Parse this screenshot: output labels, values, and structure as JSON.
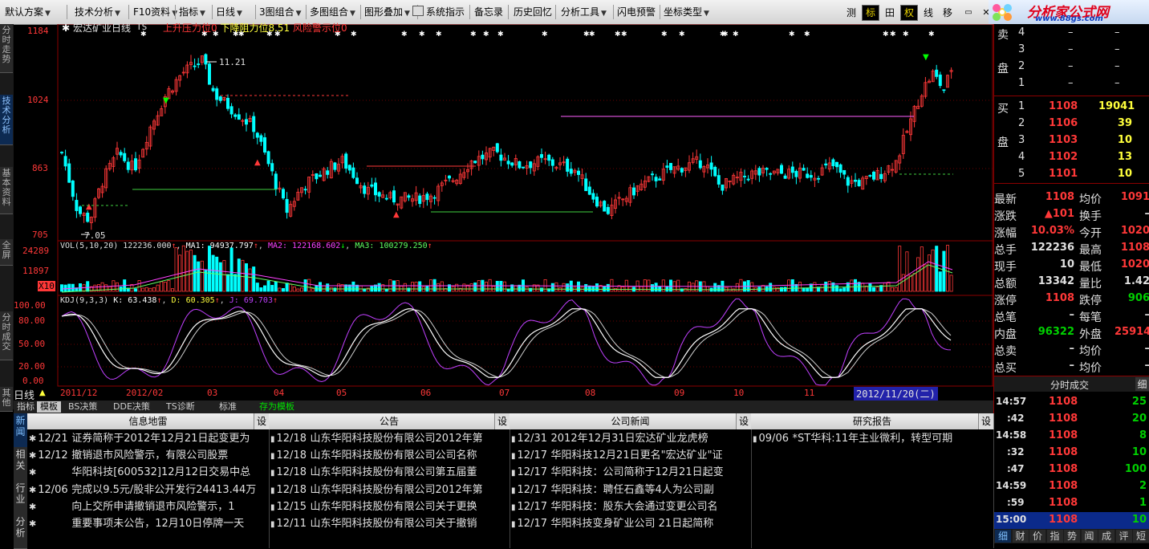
{
  "menu": {
    "items": [
      "默认方案",
      "技术分析",
      "F10资料",
      "指标",
      "日线",
      "3图组合",
      "多图组合",
      "图形叠加",
      "系统指示",
      "备忘录",
      "历史回忆",
      "分析工具",
      "闪电预警",
      "坐标类型"
    ],
    "tools": [
      "测",
      "标",
      "田",
      "权",
      "线",
      "移"
    ],
    "logo_text": "分析家公式网",
    "logo_url": "www.88gs.com"
  },
  "left_tabs": [
    "分时走势",
    "技术分析",
    "基本资料",
    "全屏",
    "分时成交",
    "其他"
  ],
  "chart": {
    "stock_name": "宏达矿业日线",
    "ts": "TS",
    "indicator_legend": [
      {
        "text": "上升压力位0",
        "color": "#ff3838"
      },
      {
        "text": "下降阻力位8.51",
        "color": "#ffff3c"
      },
      {
        "text": "风险警示位0",
        "color": "#ff3838"
      }
    ],
    "price_axis": [
      "1184",
      "1024",
      "863",
      "705"
    ],
    "high_label": "11.21",
    "low_label": "7.05",
    "vol_legend": {
      "title": "VOL(5,10,20)",
      "value": "122236.000",
      "ma1": "MA1: 94937.797",
      "ma2": "MA2: 122168.602",
      "ma3": "MA3: 100279.250"
    },
    "vol_axis": [
      "24289",
      "11897",
      "X10"
    ],
    "kdj_legend": {
      "title": "KDJ(9,3,3)",
      "k": "K: 63.438",
      "d": "D: 60.305",
      "j": "J: 69.703"
    },
    "kdj_axis": [
      "100.00",
      "80.00",
      "50.00",
      "20.00",
      "0.00"
    ],
    "period": "日线",
    "date_axis": [
      "2011/12",
      "2012/02",
      "03",
      "04",
      "05",
      "06",
      "07",
      "08",
      "09",
      "10",
      "11"
    ],
    "current_date": "2012/11/20(二)"
  },
  "order_book": {
    "sell": [
      {
        "label": "卖",
        "n": "4",
        "price": "–",
        "vol": "–"
      },
      {
        "label": "",
        "n": "3",
        "price": "–",
        "vol": "–"
      },
      {
        "label": "盘",
        "n": "2",
        "price": "–",
        "vol": "–"
      },
      {
        "label": "",
        "n": "1",
        "price": "–",
        "vol": "–"
      }
    ],
    "buy": [
      {
        "label": "买",
        "n": "1",
        "price": "1108",
        "vol": "19041"
      },
      {
        "label": "",
        "n": "2",
        "price": "1106",
        "vol": "39"
      },
      {
        "label": "盘",
        "n": "3",
        "price": "1103",
        "vol": "10"
      },
      {
        "label": "",
        "n": "4",
        "price": "1102",
        "vol": "13"
      },
      {
        "label": "",
        "n": "5",
        "price": "1101",
        "vol": "10"
      }
    ]
  },
  "quote": [
    {
      "l": "最新",
      "v": "1108",
      "vc": "red",
      "l2": "均价",
      "v2": "1091",
      "v2c": "red"
    },
    {
      "l": "涨跌",
      "v": "▲101",
      "vc": "red",
      "l2": "换手",
      "v2": "–",
      "v2c": "wht"
    },
    {
      "l": "涨幅",
      "v": "10.03%",
      "vc": "red",
      "l2": "今开",
      "v2": "1020",
      "v2c": "red"
    },
    {
      "l": "总手",
      "v": "122236",
      "vc": "wht",
      "l2": "最高",
      "v2": "1108",
      "v2c": "red"
    },
    {
      "l": "现手",
      "v": "10",
      "vc": "wht",
      "l2": "最低",
      "v2": "1020",
      "v2c": "red"
    },
    {
      "l": "总额",
      "v": "13342",
      "vc": "wht",
      "l2": "量比",
      "v2": "1.42",
      "v2c": "wht"
    },
    {
      "l": "涨停",
      "v": "1108",
      "vc": "red",
      "l2": "跌停",
      "v2": "906",
      "v2c": "grn"
    },
    {
      "l": "总笔",
      "v": "–",
      "vc": "wht",
      "l2": "每笔",
      "v2": "–",
      "v2c": "wht"
    },
    {
      "l": "内盘",
      "v": "96322",
      "vc": "grn",
      "l2": "外盘",
      "v2": "25914",
      "v2c": "red"
    },
    {
      "l": "总卖",
      "v": "–",
      "vc": "wht",
      "l2": "均价",
      "v2": "–",
      "v2c": "wht"
    },
    {
      "l": "总买",
      "v": "–",
      "vc": "wht",
      "l2": "均价",
      "v2": "–",
      "v2c": "wht"
    }
  ],
  "ticks": {
    "header": "分时成交",
    "detail": "细",
    "rows": [
      {
        "t": "14:57",
        "p": "1108",
        "v": "25",
        "vc": "grn"
      },
      {
        "t": ":42",
        "p": "1108",
        "v": "20",
        "vc": "grn"
      },
      {
        "t": "14:58",
        "p": "1108",
        "v": "8",
        "vc": "grn"
      },
      {
        "t": ":32",
        "p": "1108",
        "v": "10",
        "vc": "grn"
      },
      {
        "t": ":47",
        "p": "1108",
        "v": "100",
        "vc": "grn"
      },
      {
        "t": "14:59",
        "p": "1108",
        "v": "2",
        "vc": "grn"
      },
      {
        "t": ":59",
        "p": "1108",
        "v": "1",
        "vc": "grn"
      },
      {
        "t": "15:00",
        "p": "1108",
        "v": "10",
        "vc": "grn"
      }
    ],
    "bottom_tabs": [
      "细",
      "财",
      "价",
      "指",
      "势",
      "闻",
      "成",
      "评",
      "短"
    ]
  },
  "bottom_tabs": [
    {
      "label": "指标",
      "on": false,
      "green": false
    },
    {
      "label": "模板",
      "on": true,
      "green": false
    },
    {
      "label": "BS决策",
      "on": false,
      "green": false
    },
    {
      "label": "DDE决策",
      "on": false,
      "green": false
    },
    {
      "label": "TS诊断",
      "on": false,
      "green": false
    },
    {
      "label": "标准",
      "on": false,
      "green": false
    },
    {
      "label": "存为模板",
      "on": false,
      "green": true
    }
  ],
  "news_tabs": [
    "新闻",
    "相关",
    "行业",
    "分析"
  ],
  "news": {
    "cols": [
      {
        "title": "信息地雷",
        "set": "设",
        "items": [
          {
            "d": "12/21",
            "t": "证券简称于2012年12月21日起变更为"
          },
          {
            "d": "12/12",
            "t": "撤销退市风险警示，有限公司股票"
          },
          {
            "d": "",
            "t": "华阳科技[600532]12月12日交易中总"
          },
          {
            "d": "12/06",
            "t": "完成以9.5元/股非公开发行24413.44万"
          },
          {
            "d": "",
            "t": "向上交所申请撤销退市风险警示，1"
          },
          {
            "d": "",
            "t": "重要事项未公告，12月10日停牌一天"
          }
        ]
      },
      {
        "title": "公告",
        "set": "设",
        "items": [
          {
            "d": "12/18",
            "t": "山东华阳科技股份有限公司2012年第"
          },
          {
            "d": "12/18",
            "t": "山东华阳科技股份有限公司公司名称"
          },
          {
            "d": "12/18",
            "t": "山东华阳科技股份有限公司第五届董"
          },
          {
            "d": "12/18",
            "t": "山东华阳科技股份有限公司2012年第"
          },
          {
            "d": "12/15",
            "t": "山东华阳科技股份有限公司关于更换"
          },
          {
            "d": "12/11",
            "t": "山东华阳科技股份有限公司关于撤销"
          }
        ]
      },
      {
        "title": "公司新闻",
        "set": "设",
        "items": [
          {
            "d": "12/31",
            "t": "2012年12月31日宏达矿业龙虎榜"
          },
          {
            "d": "12/17",
            "t": "华阳科技12月21日更名\"宏达矿业\"证"
          },
          {
            "d": "12/17",
            "t": "华阳科技：公司简称于12月21日起变"
          },
          {
            "d": "12/17",
            "t": "华阳科技：聘任石鑫等4人为公司副"
          },
          {
            "d": "12/17",
            "t": "华阳科技：股东大会通过变更公司名"
          },
          {
            "d": "12/17",
            "t": "华阳科技变身矿业公司 21日起简称"
          }
        ]
      },
      {
        "title": "研究报告",
        "set": "设",
        "items": [
          {
            "d": "09/06",
            "t": "*ST华科:11年主业微利，转型可期"
          }
        ]
      }
    ]
  },
  "colors": {
    "up": "#ff3838",
    "down": "#00ffff",
    "grid": "#8b0000",
    "kdj_k": "#ffffff",
    "kdj_d": "#ffff3c",
    "kdj_j": "#c040ff",
    "ma1": "#ffffff",
    "ma2": "#ff40ff",
    "ma3": "#60ff60"
  }
}
